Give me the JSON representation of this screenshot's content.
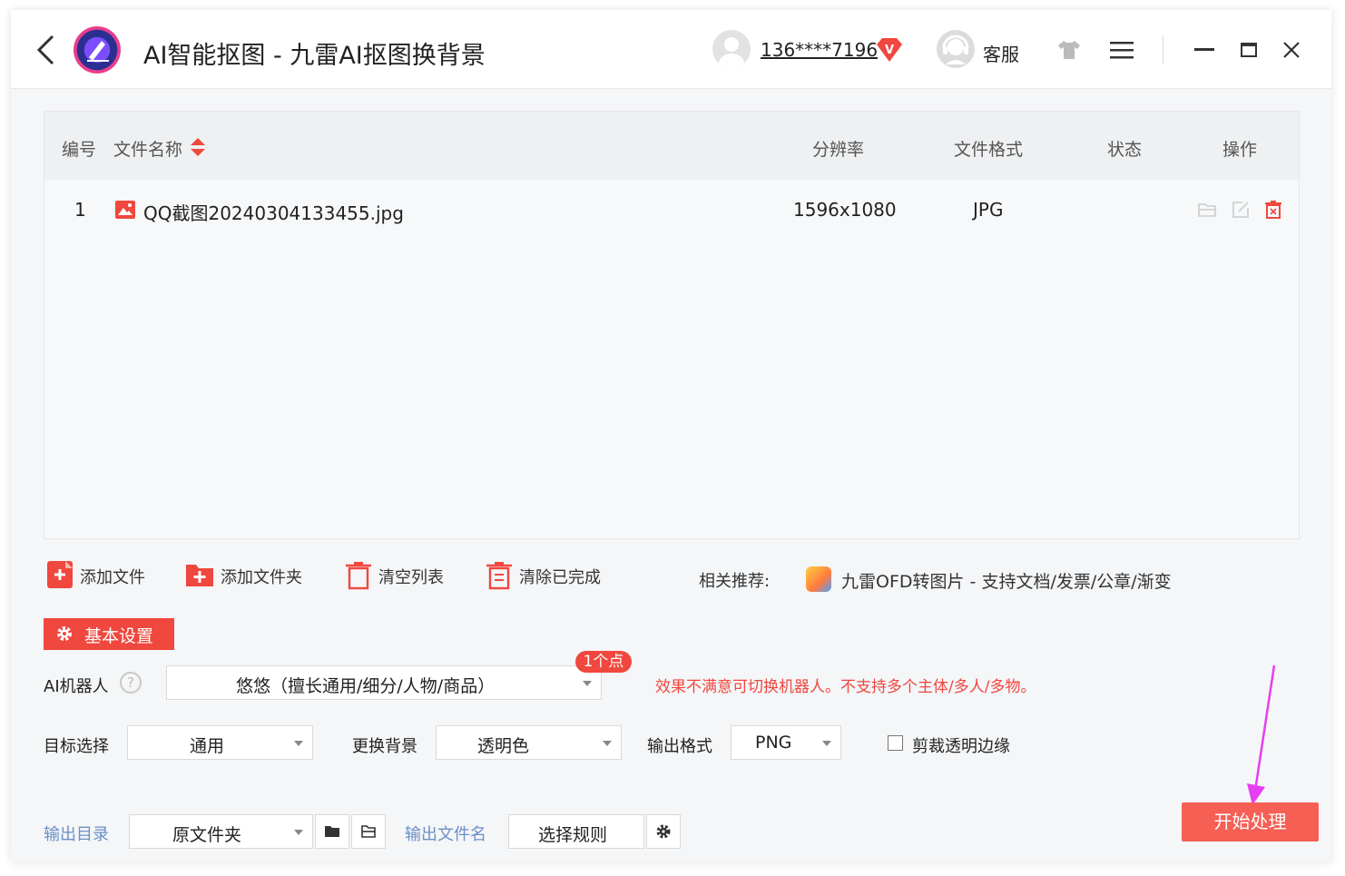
{
  "app": {
    "title": "AI智能抠图 - 九雷AI抠图换背景",
    "user_phone": "136****7196",
    "vip_letter": "V",
    "customer_service": "客服"
  },
  "table": {
    "headers": {
      "index": "编号",
      "filename": "文件名称",
      "resolution": "分辨率",
      "format": "文件格式",
      "status": "状态",
      "actions": "操作"
    },
    "rows": [
      {
        "index": "1",
        "filename": "QQ截图20240304133455.jpg",
        "resolution": "1596x1080",
        "format": "JPG",
        "status": ""
      }
    ]
  },
  "toolbar": {
    "add_file": "添加文件",
    "add_folder": "添加文件夹",
    "clear_list": "清空列表",
    "clear_done": "清除已完成",
    "recommend_label": "相关推荐:",
    "recommend_link": "九雷OFD转图片 - 支持文档/发票/公章/渐变"
  },
  "settings": {
    "tab_label": "基本设置",
    "ai_robot_label": "AI机器人",
    "help_mark": "?",
    "ai_robot_value": "悠悠（擅长通用/细分/人物/商品）",
    "points_badge": "1个点",
    "warning": "效果不满意可切换机器人。不支持多个主体/多人/多物。",
    "target_label": "目标选择",
    "target_value": "通用",
    "background_label": "更换背景",
    "background_value": "透明色",
    "output_format_label": "输出格式",
    "output_format_value": "PNG",
    "crop_label": "剪裁透明边缘",
    "crop_checked": false,
    "output_dir_label": "输出目录",
    "output_dir_value": "原文件夹",
    "output_name_label": "输出文件名",
    "output_name_value": "选择规则",
    "start_button": "开始处理"
  },
  "colors": {
    "accent_red": "#f0473e",
    "start_button": "#f65f54",
    "annotation_arrow": "#e63ef0",
    "link_blue": "#6b8fc7"
  }
}
